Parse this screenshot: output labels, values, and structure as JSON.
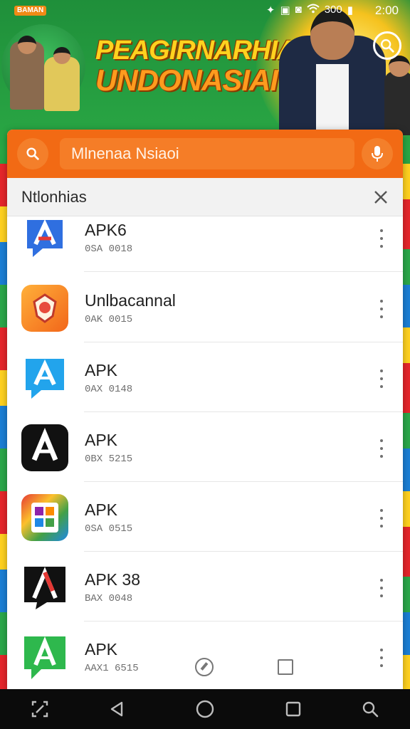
{
  "status_bar": {
    "carrier": "BAMAN",
    "signal_text": "300",
    "time": "2:00"
  },
  "banner": {
    "title_line1": "PEAGIRNARHIA",
    "title_line2": "UNDONASIAI"
  },
  "search": {
    "value": "Mlnenaa Nsiaoi"
  },
  "dialog": {
    "title": "Ntlonhias"
  },
  "apps": [
    {
      "name": "APK6",
      "size": "0SA 0018",
      "icon": "a-blue-speech-icon"
    },
    {
      "name": "Unlbacannal",
      "size": "0AK 0015",
      "icon": "orange-emblem-icon"
    },
    {
      "name": "APK",
      "size": "0AX 0148",
      "icon": "a-cyan-speech-icon"
    },
    {
      "name": "APK",
      "size": "0BX 5215",
      "icon": "a-black-icon"
    },
    {
      "name": "APK",
      "size": "0SA 0515",
      "icon": "colorful-gallery-icon"
    },
    {
      "name": "APK 38",
      "size": "BAX 0048",
      "icon": "a-red-black-icon"
    },
    {
      "name": "APK",
      "size": "AAX1 6515",
      "icon": "a-green-speech-icon"
    }
  ],
  "colors": {
    "accent": "#f26a14",
    "background_green": "#1f8f3a",
    "title_yellow": "#ffd21f"
  }
}
